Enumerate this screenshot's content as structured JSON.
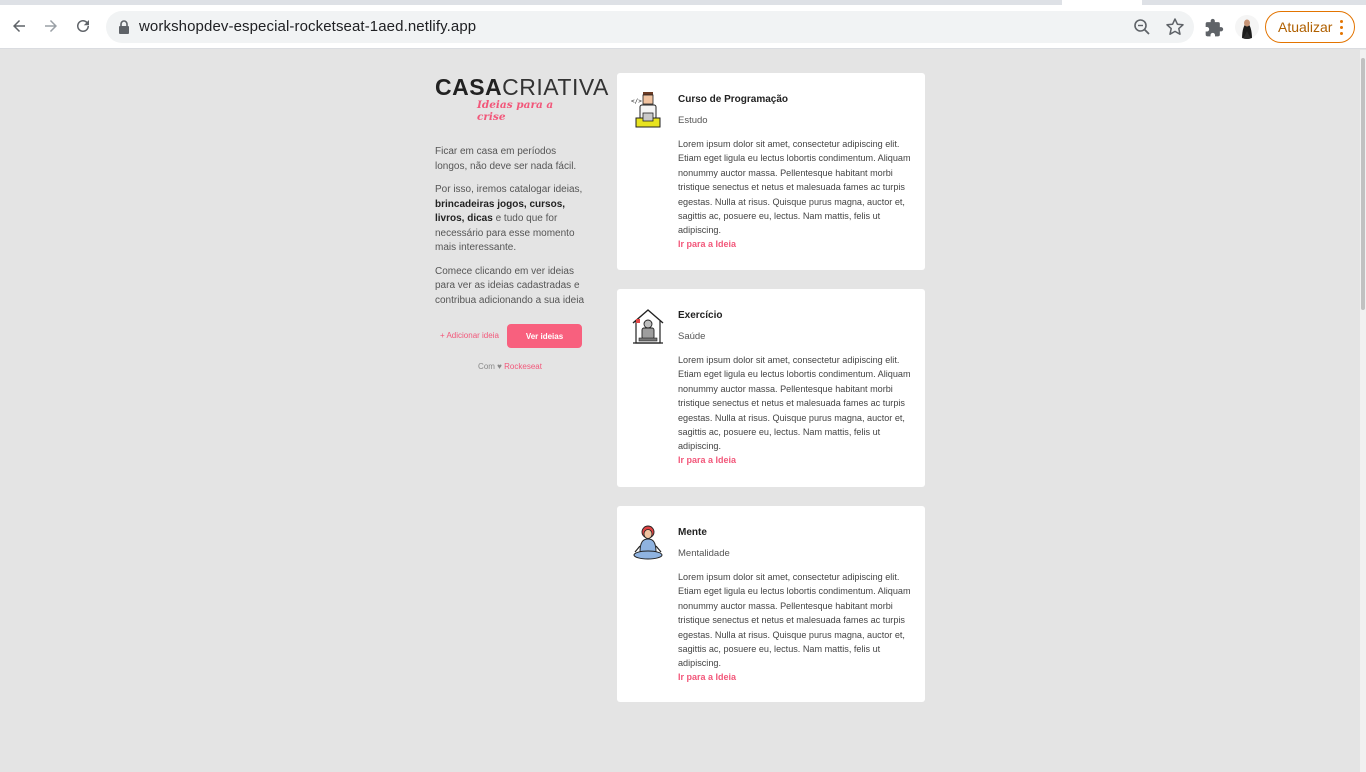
{
  "browser": {
    "url": "workshopdev-especial-rocketseat-1aed.netlify.app",
    "update_label": "Atualizar",
    "icons": {
      "back": "back-arrow-icon",
      "forward": "forward-arrow-icon",
      "reload": "reload-icon",
      "lock": "lock-icon",
      "zoom": "zoom-icon",
      "bookmark": "star-icon",
      "extensions": "puzzle-icon",
      "menu": "kebab-menu-icon"
    }
  },
  "sidebar": {
    "logo_part1": "CASA",
    "logo_part2": "CRIATIVA",
    "tagline": "Ideias para a crise",
    "intro1": "Ficar em casa em períodos longos, não deve ser nada fácil.",
    "intro2_prefix": "Por isso, iremos catalogar ideias, ",
    "intro2_bold": "brincadeiras jogos, cursos, livros, dicas",
    "intro2_suffix": " e tudo que for necessário para esse momento mais interessante.",
    "intro3": "Comece clicando em ver ideias para ver as ideias cadastradas e contribua adicionando a sua ideia",
    "add_link": "+ Adicionar ideia",
    "see_button": "Ver ideias",
    "credit_prefix": "Com",
    "credit_heart": "♥",
    "credit_brand": "Rockeseat"
  },
  "ideas": [
    {
      "title": "Curso de Programação",
      "category": "Estudo",
      "description": "Lorem ipsum dolor sit amet, consectetur adipiscing elit. Etiam eget ligula eu lectus lobortis condimentum. Aliquam nonummy auctor massa. Pellentesque habitant morbi tristique senectus et netus et malesuada fames ac turpis egestas. Nulla at risus. Quisque purus magna, auctor et, sagittis ac, posuere eu, lectus. Nam mattis, felis ut adipiscing.",
      "link": "Ir para a Ideia",
      "icon": "programmer-icon"
    },
    {
      "title": "Exercício",
      "category": "Saúde",
      "description": "Lorem ipsum dolor sit amet, consectetur adipiscing elit. Etiam eget ligula eu lectus lobortis condimentum. Aliquam nonummy auctor massa. Pellentesque habitant morbi tristique senectus et netus et malesuada fames ac turpis egestas. Nulla at risus. Quisque purus magna, auctor et, sagittis ac, posuere eu, lectus. Nam mattis, felis ut adipiscing.",
      "link": "Ir para a Ideia",
      "icon": "home-exercise-icon"
    },
    {
      "title": "Mente",
      "category": "Mentalidade",
      "description": "Lorem ipsum dolor sit amet, consectetur adipiscing elit. Etiam eget ligula eu lectus lobortis condimentum. Aliquam nonummy auctor massa. Pellentesque habitant morbi tristique senectus et netus et malesuada fames ac turpis egestas. Nulla at risus. Quisque purus magna, auctor et, sagittis ac, posuere eu, lectus. Nam mattis, felis ut adipiscing.",
      "link": "Ir para a Ideia",
      "icon": "meditation-icon"
    }
  ],
  "colors": {
    "accent": "#f8607e",
    "page_background": "#e4e4e4",
    "update_border": "#e37400"
  }
}
